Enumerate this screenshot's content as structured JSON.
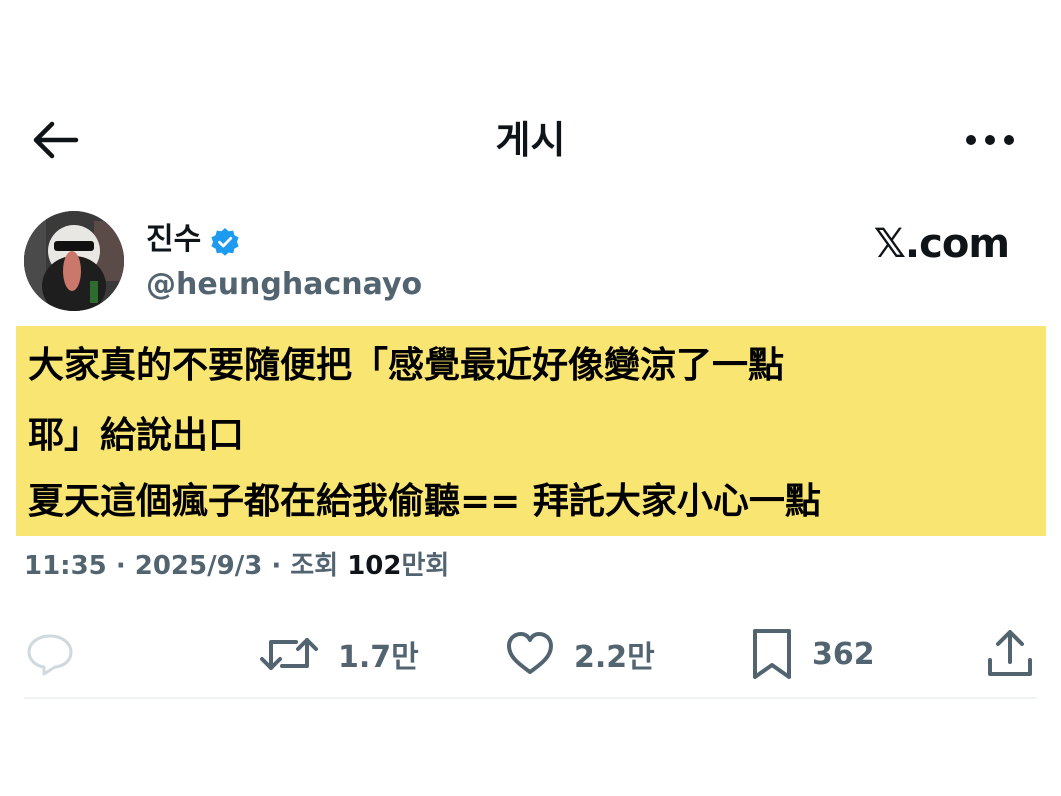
{
  "header": {
    "title": "게시",
    "back_icon": "arrow-left-icon",
    "more_icon": "more-horizontal-icon"
  },
  "author": {
    "name": "진수",
    "handle": "@heunghacnayo",
    "verified": true,
    "verified_color": "#1d9bf0"
  },
  "brand": {
    "label": "𝕏.com"
  },
  "tweet": {
    "highlight_color": "#f9e571",
    "lines": [
      "大家真的不要隨便把「感覺最近好像變涼了一點",
      "耶」給說出口",
      "夏天這個瘋子都在給我偷聽== 拜託大家小心一點"
    ]
  },
  "meta": {
    "time": "11:35",
    "separator": " · ",
    "date": "2025/9/3",
    "views_label": "조회 ",
    "views_count": "102",
    "views_unit": "만회"
  },
  "actions": {
    "reply": {
      "icon": "reply-icon",
      "count": ""
    },
    "retweet": {
      "icon": "retweet-icon",
      "count": "1.7만"
    },
    "like": {
      "icon": "heart-icon",
      "count": "2.2만"
    },
    "bookmark": {
      "icon": "bookmark-icon",
      "count": "362"
    },
    "share": {
      "icon": "share-icon",
      "count": ""
    }
  },
  "colors": {
    "text_primary": "#0f1419",
    "text_secondary": "#536471",
    "divider": "#eff3f4"
  }
}
